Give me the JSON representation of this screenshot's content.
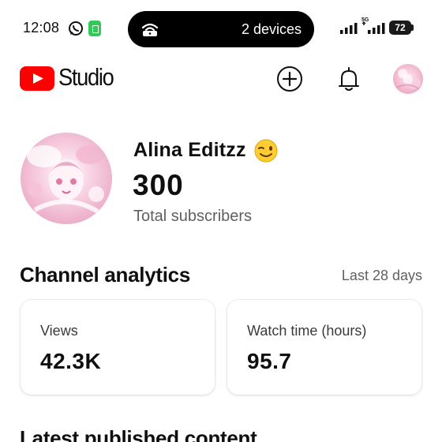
{
  "status_bar": {
    "time": "12:08",
    "island_text": "2 devices",
    "network_label": "5G",
    "battery_level": "72",
    "icons": [
      "whatsapp-icon",
      "app-notification-icon",
      "hotspot-icon",
      "signal-icon",
      "signal-5g-icon",
      "battery-icon"
    ]
  },
  "header": {
    "brand_name": "Studio",
    "brand_color": "#ff0000",
    "icons": [
      "youtube-logo-icon",
      "create-plus-icon",
      "bell-icon",
      "profile-avatar"
    ]
  },
  "channel": {
    "name": "Alina Editzz",
    "emoji_icon": "wink-emoji-icon",
    "subscriber_count": "300",
    "subscriber_label": "Total subscribers"
  },
  "analytics": {
    "title": "Channel analytics",
    "range": "Last 28 days",
    "cards": [
      {
        "label": "Views",
        "value": "42.3K"
      },
      {
        "label": "Watch time (hours)",
        "value": "95.7"
      }
    ]
  },
  "latest_content": {
    "title": "Latest published content"
  }
}
